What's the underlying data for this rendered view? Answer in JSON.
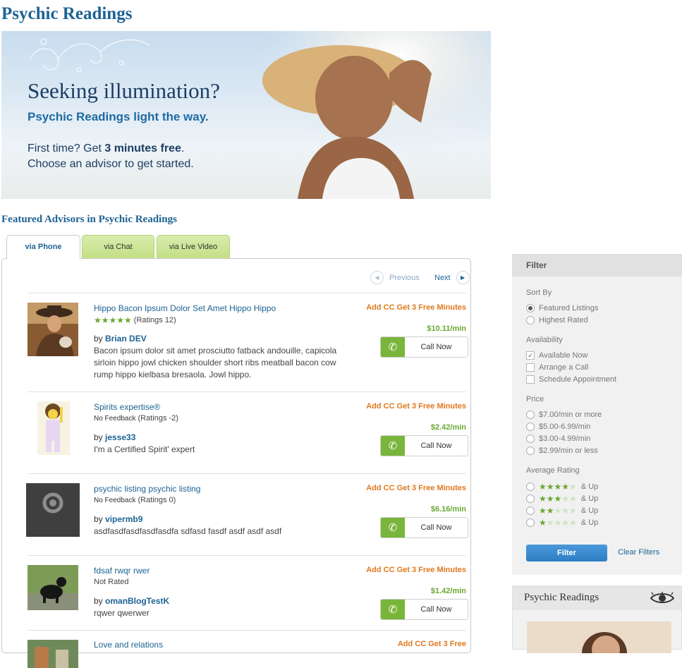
{
  "page": {
    "title": "Psychic Readings"
  },
  "hero": {
    "headline": "Seeking illumination?",
    "subheadline": "Psychic Readings light the way.",
    "line1_prefix": "First time? Get ",
    "line1_bold": "3 minutes free",
    "line1_suffix": ".",
    "line2": "Choose an advisor to get started."
  },
  "section": {
    "title": "Featured Advisors in Psychic Readings"
  },
  "tabs": [
    {
      "label": "via Phone",
      "active": true
    },
    {
      "label": "via Chat",
      "active": false
    },
    {
      "label": "via Live Video",
      "active": false
    }
  ],
  "pager": {
    "previous": "Previous",
    "next": "Next"
  },
  "advisors": [
    {
      "title": "Hippo Bacon Ipsum Dolor Set Amet Hippo Hippo",
      "stars": 5,
      "rating_text": "(Ratings 12)",
      "by_prefix": "by ",
      "name": "Brian DEV",
      "description": "Bacon ipsum dolor sit amet prosciutto fatback andouille, capicola sirloin hippo jowl chicken shoulder short ribs meatball bacon cow rump hippo kielbasa bresaola. Jowl hippo.",
      "promo": "Add CC Get 3 Free Minutes",
      "price": "$10.11/min",
      "button": "Call Now"
    },
    {
      "title": "Spirits expertise®",
      "feedback": "No Feedback",
      "rating_text": "(Ratings -2)",
      "by_prefix": "by ",
      "name": "jesse33",
      "description": "I'm a Certified Spirit' expert",
      "promo": "Add CC Get 3 Free Minutes",
      "price": "$2.42/min",
      "button": "Call Now"
    },
    {
      "title": "psychic listing psychic listing",
      "feedback": "No Feedback",
      "rating_text": "(Ratings 0)",
      "by_prefix": "by ",
      "name": "vipermb9",
      "description": "asdfasdfasdfasdfasdfa sdfasd fasdf asdf asdf asdf",
      "promo": "Add CC Get 3 Free Minutes",
      "price": "$6.16/min",
      "button": "Call Now"
    },
    {
      "title": "fdsaf rwqr rwer",
      "feedback": "Not Rated",
      "by_prefix": "by ",
      "name": "omanBlogTestK",
      "description": "rqwer qwerwer",
      "promo": "Add CC Get 3 Free Minutes",
      "price": "$1.42/min",
      "button": "Call Now"
    },
    {
      "title": "Love and relations",
      "promo": "Add CC Get 3 Free"
    }
  ],
  "filter": {
    "header": "Filter",
    "sort_label": "Sort By",
    "sort_options": [
      "Featured Listings",
      "Highest Rated"
    ],
    "sort_selected": "Featured Listings",
    "availability_label": "Availability",
    "availability_options": [
      "Available Now",
      "Arrange a Call",
      "Schedule Appointment"
    ],
    "availability_checked": [
      "Available Now"
    ],
    "price_label": "Price",
    "price_options": [
      "$7.00/min or more",
      "$5.00-6.99/min",
      "$3.00-4.99/min",
      "$2.99/min or less"
    ],
    "rating_label": "Average Rating",
    "rating_options": [
      {
        "stars": 4,
        "suffix": "& Up"
      },
      {
        "stars": 3,
        "suffix": "& Up"
      },
      {
        "stars": 2,
        "suffix": "& Up"
      },
      {
        "stars": 1,
        "suffix": "& Up"
      }
    ],
    "filter_button": "Filter",
    "clear_link": "Clear Filters"
  },
  "sidebar_box": {
    "title": "Psychic Readings",
    "icon": "eye-icon"
  },
  "colors": {
    "accent_blue": "#1d6394",
    "promo_orange": "#e0781f",
    "price_green": "#6aa832",
    "tab_green": "#c3df86"
  }
}
